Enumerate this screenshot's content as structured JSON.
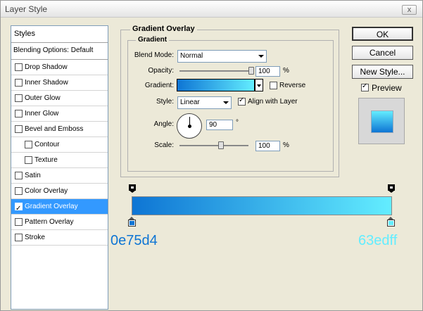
{
  "window": {
    "title": "Layer Style",
    "close_label": "x"
  },
  "styles_panel": {
    "header": "Styles",
    "blending_options": "Blending Options: Default",
    "items": [
      {
        "label": "Drop Shadow",
        "checked": false,
        "selected": false,
        "sub": false
      },
      {
        "label": "Inner Shadow",
        "checked": false,
        "selected": false,
        "sub": false
      },
      {
        "label": "Outer Glow",
        "checked": false,
        "selected": false,
        "sub": false
      },
      {
        "label": "Inner Glow",
        "checked": false,
        "selected": false,
        "sub": false
      },
      {
        "label": "Bevel and Emboss",
        "checked": false,
        "selected": false,
        "sub": false
      },
      {
        "label": "Contour",
        "checked": false,
        "selected": false,
        "sub": true
      },
      {
        "label": "Texture",
        "checked": false,
        "selected": false,
        "sub": true
      },
      {
        "label": "Satin",
        "checked": false,
        "selected": false,
        "sub": false
      },
      {
        "label": "Color Overlay",
        "checked": false,
        "selected": false,
        "sub": false
      },
      {
        "label": "Gradient Overlay",
        "checked": true,
        "selected": true,
        "sub": false
      },
      {
        "label": "Pattern Overlay",
        "checked": false,
        "selected": false,
        "sub": false
      },
      {
        "label": "Stroke",
        "checked": false,
        "selected": false,
        "sub": false
      }
    ]
  },
  "gradient_overlay": {
    "group_title": "Gradient Overlay",
    "subgroup_title": "Gradient",
    "blend_mode_label": "Blend Mode:",
    "blend_mode_value": "Normal",
    "opacity_label": "Opacity:",
    "opacity_value": "100",
    "opacity_unit": "%",
    "opacity_fraction": 1.0,
    "gradient_label": "Gradient:",
    "reverse_label": "Reverse",
    "reverse_checked": false,
    "style_label": "Style:",
    "style_value": "Linear",
    "align_label": "Align with Layer",
    "align_checked": true,
    "angle_label": "Angle:",
    "angle_value": "90",
    "angle_unit": "°",
    "scale_label": "Scale:",
    "scale_value": "100",
    "scale_unit": "%",
    "scale_fraction": 0.6,
    "check_mark": "✓"
  },
  "buttons": {
    "ok": "OK",
    "cancel": "Cancel",
    "new_style": "New Style...",
    "preview_label": "Preview",
    "preview_checked": true
  },
  "gradient_editor": {
    "start_color": "#0e75d4",
    "end_color": "#63edff",
    "start_hex_label": "0e75d4",
    "end_hex_label": "63edff"
  }
}
